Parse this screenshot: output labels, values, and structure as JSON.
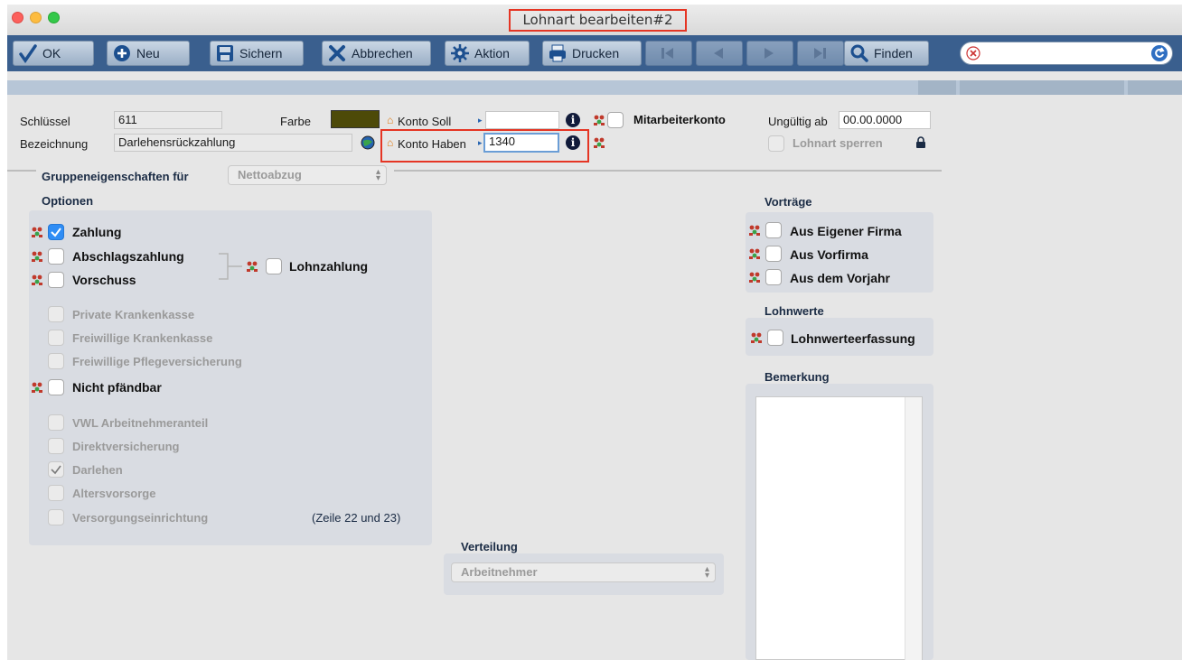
{
  "window": {
    "title": "Lohnart bearbeiten#2"
  },
  "toolbar": {
    "ok": "OK",
    "neu": "Neu",
    "sichern": "Sichern",
    "abbrechen": "Abbrechen",
    "aktion": "Aktion",
    "drucken": "Drucken",
    "finden": "Finden",
    "search_value": ""
  },
  "header": {
    "schluessel_label": "Schlüssel",
    "schluessel_value": "611",
    "farbe_label": "Farbe",
    "farbe_color": "#4d4a08",
    "bezeichnung_label": "Bezeichnung",
    "bezeichnung_value": "Darlehensrückzahlung",
    "konto_soll_label": "Konto Soll",
    "konto_soll_value": "",
    "konto_haben_label": "Konto Haben",
    "konto_haben_value": "1340",
    "mitarbeiterkonto_label": "Mitarbeiterkonto",
    "ungueltig_label": "Ungültig ab",
    "ungueltig_value": "00.00.0000",
    "lohnart_sperren_label": "Lohnart sperren"
  },
  "gruppe": {
    "label": "Gruppeneigenschaften für",
    "selected": "Nettoabzug"
  },
  "optionen": {
    "title": "Optionen",
    "zahlung": "Zahlung",
    "abschlagszahlung": "Abschlagszahlung",
    "vorschuss": "Vorschuss",
    "lohnzahlung": "Lohnzahlung",
    "private_kk": "Private Krankenkasse",
    "freiwillige_kk": "Freiwillige Krankenkasse",
    "freiwillige_pv": "Freiwillige Pflegeversicherung",
    "nicht_pfaendbar": "Nicht pfändbar",
    "vwl": "VWL Arbeitnehmeranteil",
    "direktversicherung": "Direktversicherung",
    "darlehen": "Darlehen",
    "altersvorsorge": "Altersvorsorge",
    "versorgung": "Versorgungseinrichtung",
    "zeile_note": "(Zeile 22 und 23)"
  },
  "vortraege": {
    "title": "Vorträge",
    "eigene_firma": "Aus Eigener Firma",
    "vorfirma": "Aus Vorfirma",
    "vorjahr": "Aus dem Vorjahr"
  },
  "lohnwerte": {
    "title": "Lohnwerte",
    "erfassung": "Lohnwerteerfassung"
  },
  "bemerkung": {
    "title": "Bemerkung",
    "text": ""
  },
  "verteilung": {
    "title": "Verteilung",
    "selected": "Arbeitnehmer"
  }
}
